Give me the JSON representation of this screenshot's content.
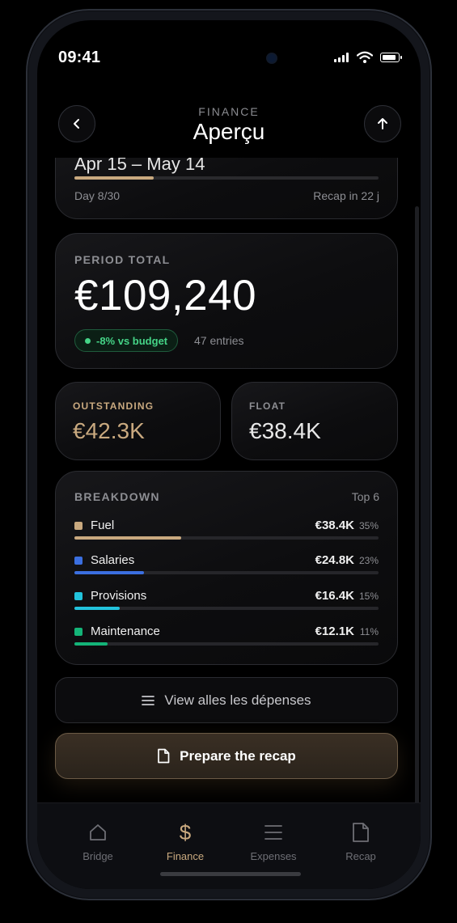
{
  "status": {
    "time": "09:41"
  },
  "header": {
    "kicker": "FINANCE",
    "title": "Aperçu"
  },
  "period": {
    "range": "Apr 15 – May 14",
    "progress": 0.26,
    "day": "Day 8/30",
    "recap": "Recap in 22 j"
  },
  "total": {
    "label": "PERIOD TOTAL",
    "value": "€109,240",
    "delta": "-8% vs budget",
    "entries": "47 entries"
  },
  "outstanding": {
    "label": "OUTSTANDING",
    "value": "€42.3K",
    "color": "#c9a97f"
  },
  "float": {
    "label": "FLOAT",
    "value": "€38.4K",
    "color": "#e8e8e8"
  },
  "breakdown": {
    "label": "BREAKDOWN",
    "top": "Top 6",
    "items": [
      {
        "name": "Fuel",
        "amount": "€38.4K",
        "pct": "35%",
        "fraction": 0.35,
        "color": "#c9a97f"
      },
      {
        "name": "Salaries",
        "amount": "€24.8K",
        "pct": "23%",
        "fraction": 0.23,
        "color": "#3b6fe0"
      },
      {
        "name": "Provisions",
        "amount": "€16.4K",
        "pct": "15%",
        "fraction": 0.15,
        "color": "#22c3dc"
      },
      {
        "name": "Maintenance",
        "amount": "€12.1K",
        "pct": "11%",
        "fraction": 0.11,
        "color": "#14b478"
      }
    ]
  },
  "actions": {
    "view_all": "View alles les dépenses",
    "prepare": "Prepare the recap"
  },
  "tabs": [
    {
      "label": "Bridge",
      "icon": "home-icon"
    },
    {
      "label": "Finance",
      "icon": "dollar-icon",
      "active": true
    },
    {
      "label": "Expenses",
      "icon": "list-icon"
    },
    {
      "label": "Recap",
      "icon": "document-icon"
    }
  ]
}
